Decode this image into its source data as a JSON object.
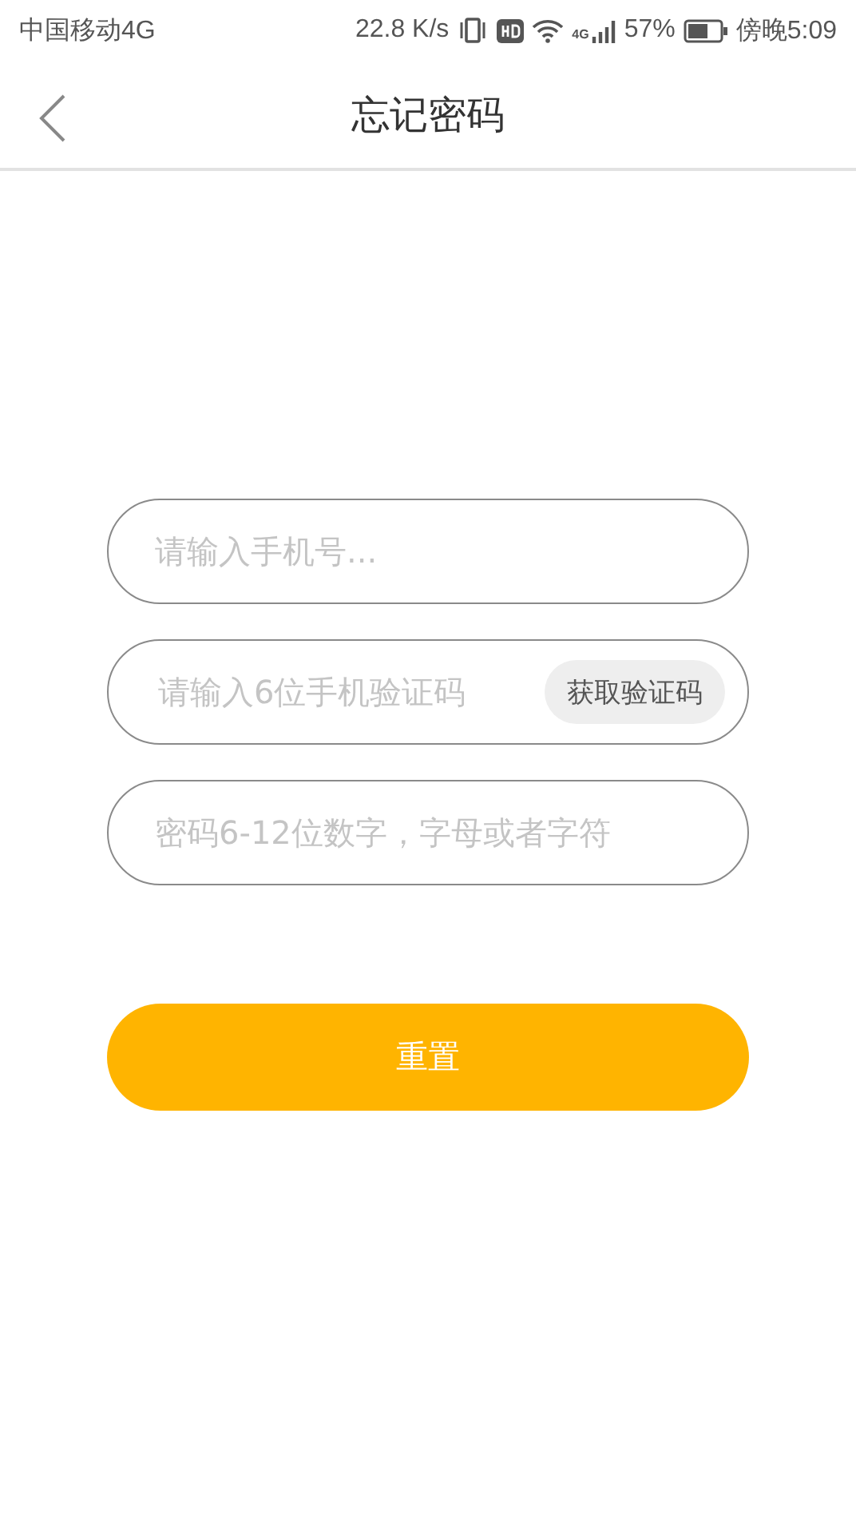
{
  "status_bar": {
    "carrier": "中国移动4G",
    "speed": "22.8 K/s",
    "network": "4G",
    "battery": "57%",
    "time": "傍晚5:09"
  },
  "header": {
    "title": "忘记密码"
  },
  "fields": [
    {
      "kind": "text",
      "placeholder": "请输入手机号..."
    },
    {
      "kind": "code",
      "placeholder": "请输入6位手机验证码",
      "button": "获取验证码"
    },
    {
      "kind": "text",
      "placeholder": "密码6-12位数字，字母或者字符"
    }
  ],
  "submit": "重置"
}
